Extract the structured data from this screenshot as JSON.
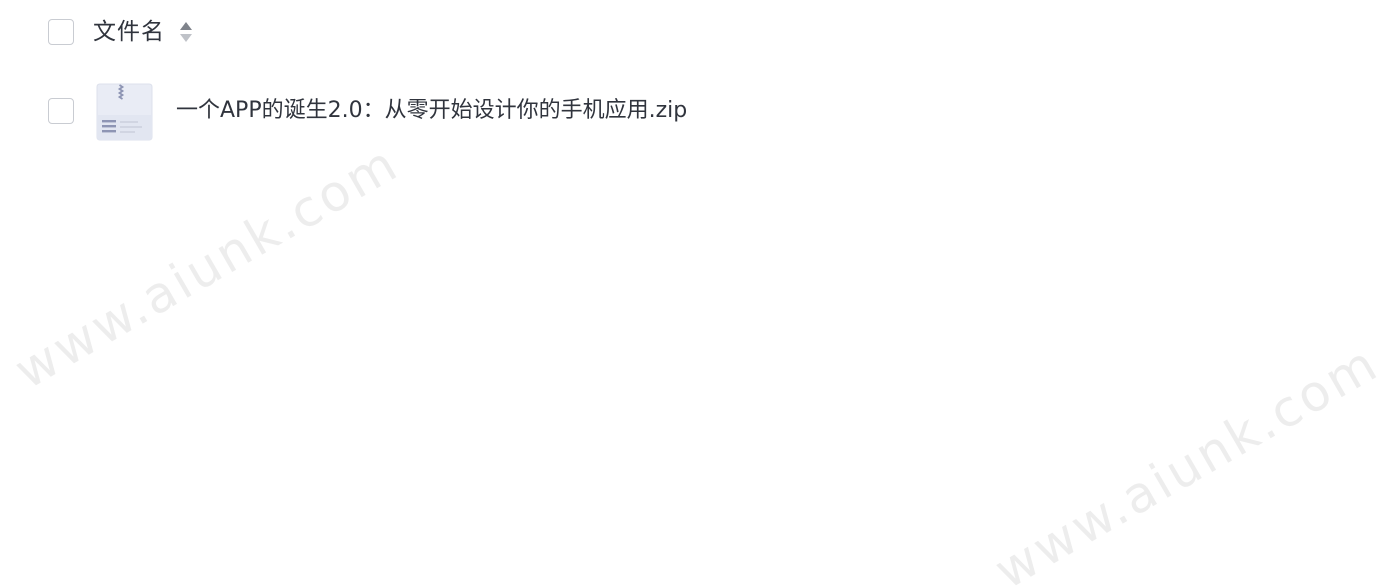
{
  "header": {
    "column_label": "文件名"
  },
  "files": [
    {
      "name": "一个APP的诞生2.0：从零开始设计你的手机应用.zip",
      "icon": "zip-file-icon"
    }
  ],
  "watermarks": [
    "www.aiunk.com",
    "www.aiunk.com"
  ]
}
